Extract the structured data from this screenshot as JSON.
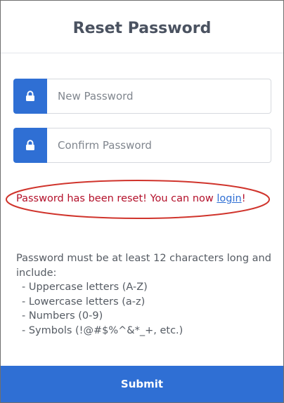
{
  "header": {
    "title": "Reset Password"
  },
  "form": {
    "new_password": {
      "placeholder": "New Password",
      "value": "",
      "icon": "lock-icon"
    },
    "confirm_password": {
      "placeholder": "Confirm Password",
      "value": "",
      "icon": "lock-icon"
    }
  },
  "message": {
    "text": "Password has been reset! You can now ",
    "link_label": "login",
    "suffix": "!",
    "color": "#b3102a",
    "highlight_color": "#d0342c"
  },
  "requirements": {
    "intro": "Password must be at least 12 characters long and include:",
    "items": [
      "- Uppercase letters (A-Z)",
      "- Lowercase letters (a-z)",
      "- Numbers (0-9)",
      "- Symbols (!@#$%^&*_+, etc.)"
    ]
  },
  "submit": {
    "label": "Submit"
  },
  "colors": {
    "accent": "#2f6fd4",
    "title": "#4a5260"
  }
}
